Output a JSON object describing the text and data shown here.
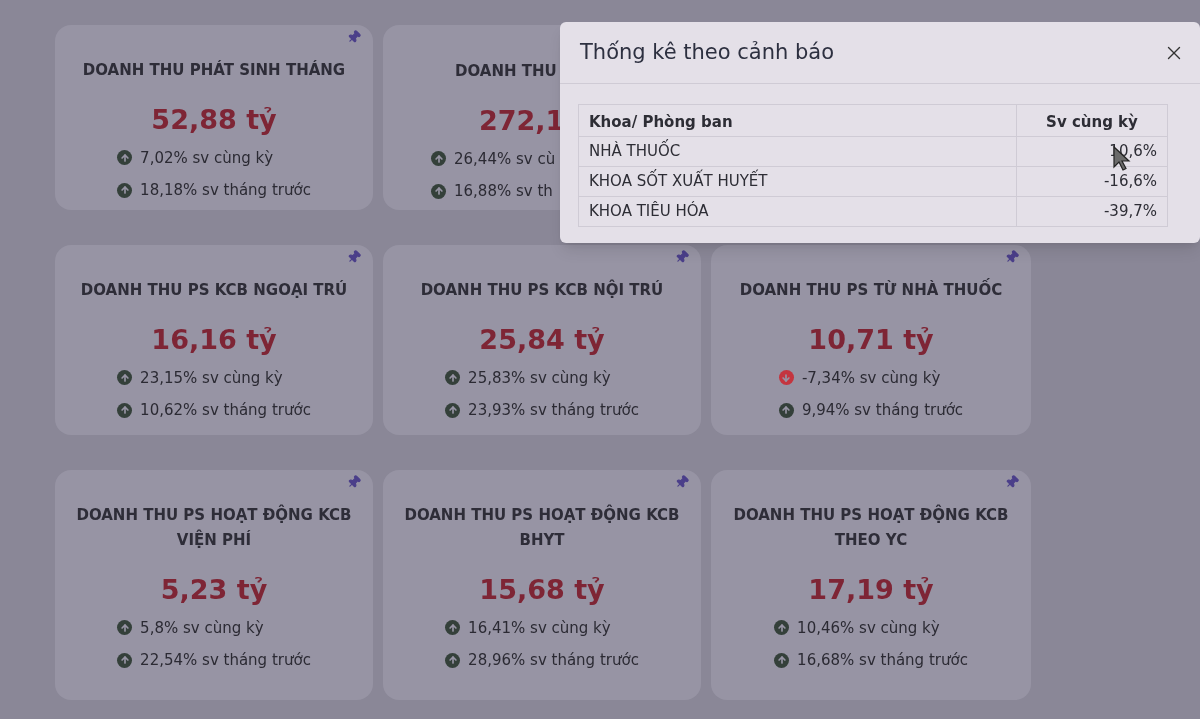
{
  "cards": [
    {
      "title": "DOANH THU PHÁT SINH THÁNG",
      "value": "52,88 tỷ",
      "covered": false,
      "stats": [
        {
          "kind": "up",
          "text": "7,02% sv cùng kỳ"
        },
        {
          "kind": "up",
          "text": "18,18% sv tháng trước"
        }
      ]
    },
    {
      "title": "DOANH THU",
      "value": "272,1",
      "covered": true,
      "stats": [
        {
          "kind": "up",
          "text": "26,44% sv cù"
        },
        {
          "kind": "up",
          "text": "16,88% sv th"
        }
      ]
    },
    {
      "title": "DOANH THU PS KCB NGOẠI TRÚ",
      "value": "16,16 tỷ",
      "covered": false,
      "stats": [
        {
          "kind": "up",
          "text": "23,15% sv cùng kỳ"
        },
        {
          "kind": "up",
          "text": "10,62% sv tháng trước"
        }
      ]
    },
    {
      "title": "DOANH THU PS KCB NỘI TRÚ",
      "value": "25,84 tỷ",
      "covered": false,
      "stats": [
        {
          "kind": "up",
          "text": "25,83% sv cùng kỳ"
        },
        {
          "kind": "up",
          "text": "23,93% sv tháng trước"
        }
      ]
    },
    {
      "title": "DOANH THU PS TỪ NHÀ THUỐC",
      "value": "10,71 tỷ",
      "covered": false,
      "stats": [
        {
          "kind": "down",
          "text": "-7,34% sv cùng kỳ"
        },
        {
          "kind": "up",
          "text": "9,94% sv tháng trước"
        }
      ]
    },
    {
      "title": "DOANH THU PS HOẠT ĐỘNG KCB VIỆN PHÍ",
      "value": "5,23 tỷ",
      "covered": false,
      "stats": [
        {
          "kind": "up",
          "text": "5,8% sv cùng kỳ"
        },
        {
          "kind": "up",
          "text": "22,54% sv tháng trước"
        }
      ]
    },
    {
      "title": "DOANH THU PS HOẠT ĐỘNG KCB BHYT",
      "value": "15,68 tỷ",
      "covered": false,
      "stats": [
        {
          "kind": "up",
          "text": "16,41% sv cùng kỳ"
        },
        {
          "kind": "up",
          "text": "28,96% sv tháng trước"
        }
      ]
    },
    {
      "title": "DOANH THU PS HOẠT ĐỘNG KCB THEO YC",
      "value": "17,19 tỷ",
      "covered": false,
      "stats": [
        {
          "kind": "up",
          "text": "10,46% sv cùng kỳ"
        },
        {
          "kind": "up",
          "text": "16,68% sv tháng trước"
        }
      ]
    }
  ],
  "dialog": {
    "title": "Thống kê theo cảnh báo",
    "table": {
      "columns": [
        "Khoa/ Phòng ban",
        "Sv cùng kỳ"
      ],
      "rows": [
        [
          "NHÀ THUỐC",
          "10,6%"
        ],
        [
          "KHOA SỐT XUẤT HUYẾT",
          "-16,6%"
        ],
        [
          "KHOA TIÊU HÓA",
          "-39,7%"
        ]
      ]
    }
  }
}
